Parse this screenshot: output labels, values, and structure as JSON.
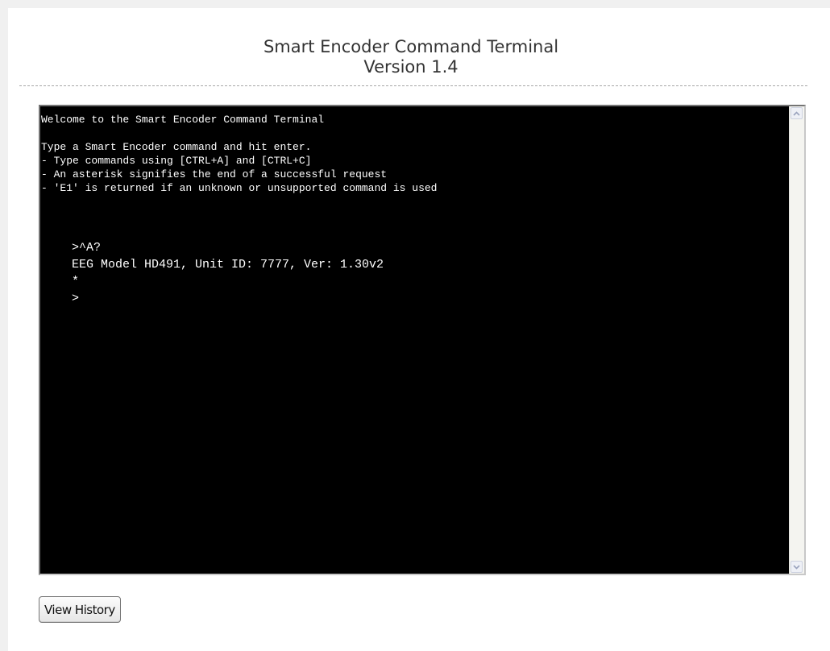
{
  "header": {
    "title": "Smart Encoder Command Terminal",
    "version": "Version 1.4"
  },
  "terminal": {
    "welcome": "Welcome to the Smart Encoder Command Terminal",
    "help_lines": [
      "Type a Smart Encoder command and hit enter.",
      "- Type commands using [CTRL+A] and [CTRL+C]",
      "- An asterisk signifies the end of a successful request",
      "- 'E1' is returned if an unknown or unsupported command is used"
    ],
    "session_lines": [
      ">^A?",
      "EEG Model HD491, Unit ID: 7777, Ver: 1.30v2",
      "*",
      ">"
    ]
  },
  "actions": {
    "view_history_label": "View History"
  },
  "colors": {
    "terminal_background": "#000000",
    "terminal_text": "#ffffff",
    "page_background": "#ffffff"
  },
  "icons": {
    "scroll_up": "chevron-up-icon",
    "scroll_down": "chevron-down-icon"
  }
}
